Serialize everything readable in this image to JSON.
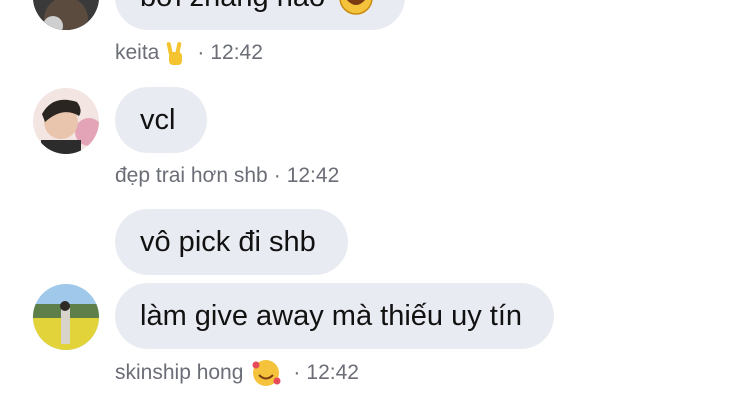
{
  "messages": [
    {
      "text": "bởi zhang nào"
    },
    {
      "text": "vcl"
    },
    {
      "text": "vô pick đi shb"
    },
    {
      "text": "làm give away mà thiếu uy tín"
    }
  ],
  "meta": [
    {
      "name": "keita",
      "separator": "·",
      "time": "12:42",
      "emoji": "victory-hand"
    },
    {
      "name": "đẹp trai hơn shb",
      "separator": "·",
      "time": "12:42"
    },
    {
      "name": "skinship hong",
      "separator": "·",
      "time": "12:42",
      "emoji": "smiling-face-with-hearts"
    }
  ]
}
